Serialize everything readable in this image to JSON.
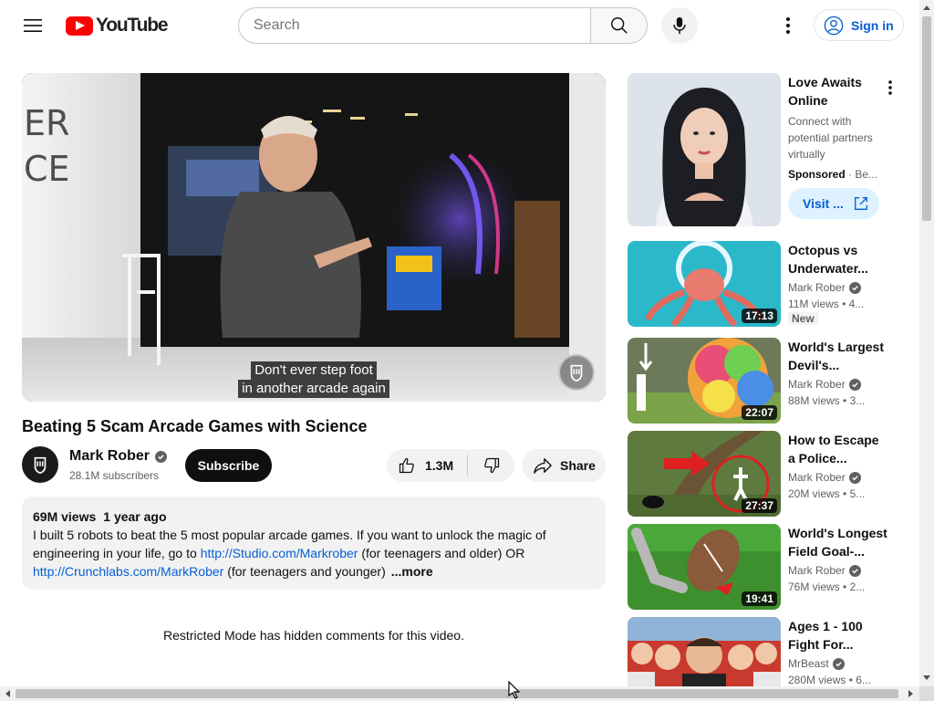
{
  "header": {
    "logo_text": "YouTube",
    "search_placeholder": "Search",
    "sign_in_label": "Sign in"
  },
  "player": {
    "caption_line1": "Don't ever step foot",
    "caption_line2": "in another arcade again"
  },
  "video": {
    "title": "Beating 5 Scam Arcade Games with Science",
    "channel_name": "Mark Rober",
    "subscribers": "28.1M subscribers",
    "subscribe_label": "Subscribe",
    "likes": "1.3M",
    "share_label": "Share"
  },
  "description": {
    "views": "69M views",
    "age": "1 year ago",
    "text_part1": "I built 5 robots to beat the 5 most popular arcade games.  If you want to unlock the magic of engineering in your life, go to ",
    "link1": "http://Studio.com/Markrober",
    "text_part2": " (for teenagers and older) OR ",
    "link2": "http://Crunchlabs.com/MarkRober",
    "text_part3": " (for teenagers and younger)",
    "more_label": "...more"
  },
  "comments": {
    "restricted_text": "Restricted Mode has hidden comments for this video."
  },
  "sidebar": {
    "ad": {
      "title": "Love Awaits Online",
      "description": "Connect with potential partners virtually",
      "sponsored": "Sponsored",
      "advertiser": "Be...",
      "visit_label": "Visit ..."
    },
    "items": [
      {
        "title": "Octopus vs Underwater...",
        "channel": "Mark Rober",
        "views": "11M views",
        "age": "4...",
        "duration": "17:13",
        "badge": "New"
      },
      {
        "title": "World's Largest Devil's...",
        "channel": "Mark Rober",
        "views": "88M views",
        "age": "3...",
        "duration": "22:07"
      },
      {
        "title": "How to Escape a Police...",
        "channel": "Mark Rober",
        "views": "20M views",
        "age": "5...",
        "duration": "27:37"
      },
      {
        "title": "World's Longest Field Goal-...",
        "channel": "Mark Rober",
        "views": "76M views",
        "age": "2...",
        "duration": "19:41"
      },
      {
        "title": "Ages 1 - 100 Fight For...",
        "channel": "MrBeast",
        "views": "280M views",
        "age": "6..."
      }
    ]
  },
  "colors": {
    "brand_red": "#ff0000",
    "link_blue": "#065fd4",
    "chip_grey": "#f2f2f2"
  }
}
